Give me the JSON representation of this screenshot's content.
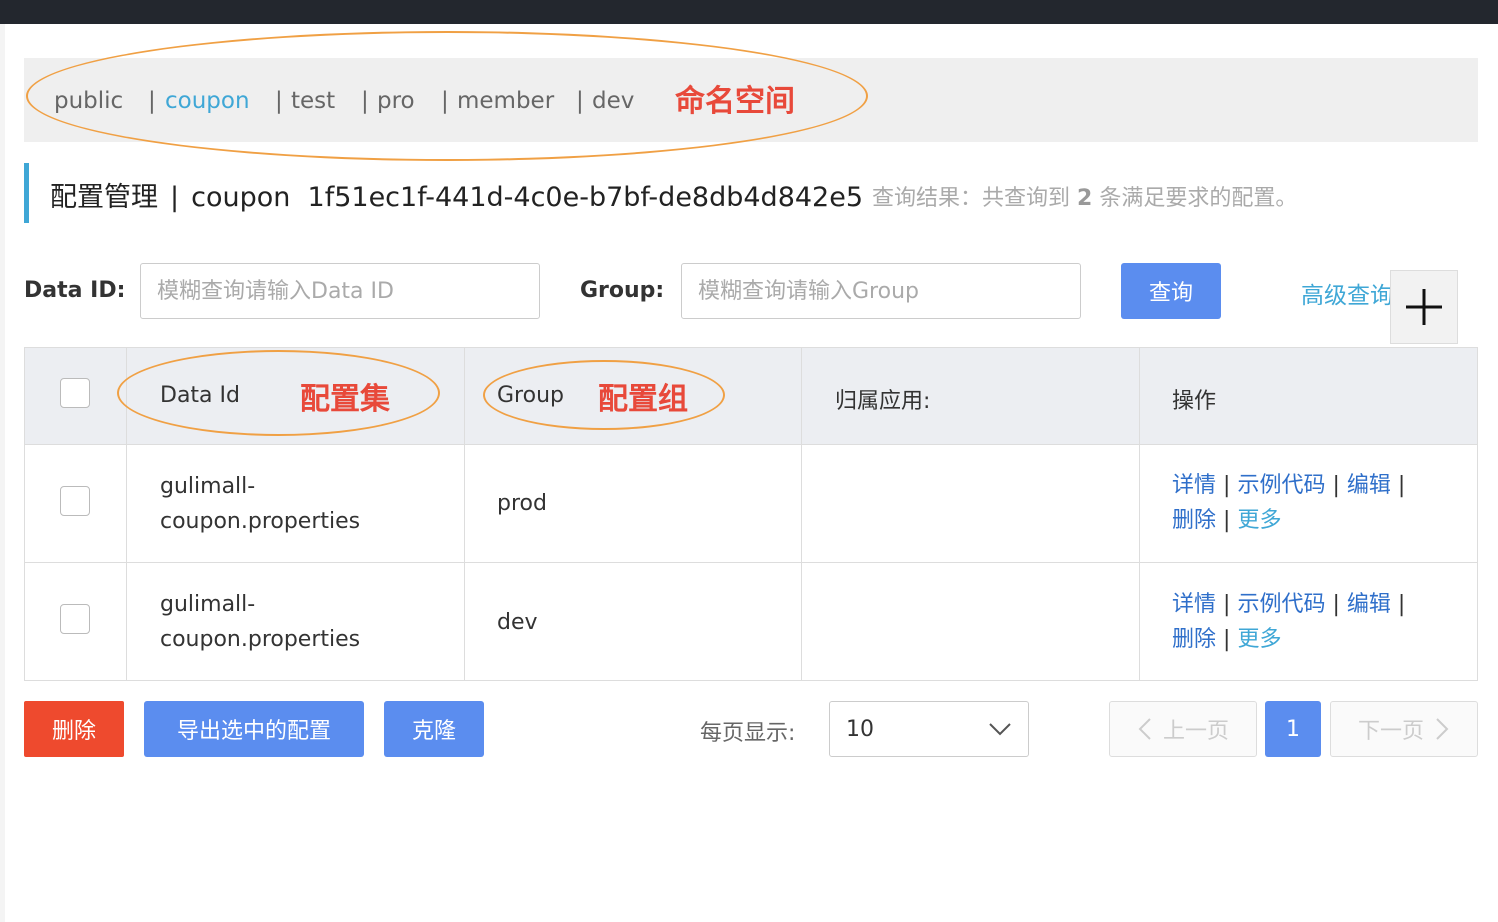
{
  "namespaces": {
    "items": [
      "public",
      "coupon",
      "test",
      "pro",
      "member",
      "dev"
    ],
    "active": "coupon",
    "separator": "|",
    "annotation": "命名空间"
  },
  "header": {
    "title": "配置管理",
    "separator": "|",
    "namespace_name": "coupon",
    "namespace_id": "1f51ec1f-441d-4c0e-b7bf-de8db4d842e5",
    "result_prefix": "查询结果：共查询到",
    "result_count": "2",
    "result_suffix": "条满足要求的配置。"
  },
  "search": {
    "data_id_label": "Data ID:",
    "data_id_placeholder": "模糊查询请输入Data ID",
    "group_label": "Group:",
    "group_placeholder": "模糊查询请输入Group",
    "query_button": "查询",
    "advanced_query": "高级查询",
    "add_icon": "plus-icon"
  },
  "table": {
    "columns": [
      "Data Id",
      "Group",
      "归属应用:",
      "操作"
    ],
    "annotations": {
      "data_id": "配置集",
      "group": "配置组"
    },
    "rows": [
      {
        "data_id_line1": "gulimall-",
        "data_id_line2": "coupon.properties",
        "group": "prod",
        "app": ""
      },
      {
        "data_id_line1": "gulimall-",
        "data_id_line2": "coupon.properties",
        "group": "dev",
        "app": ""
      }
    ],
    "actions": {
      "detail": "详情",
      "sample_code": "示例代码",
      "edit": "编辑",
      "delete": "删除",
      "more": "更多",
      "sep": "|"
    }
  },
  "footer": {
    "delete_button": "删除",
    "export_button": "导出选中的配置",
    "clone_button": "克隆",
    "page_size_label": "每页显示:",
    "page_size_value": "10",
    "prev_page": "上一页",
    "current_page": "1",
    "next_page": "下一页"
  },
  "colors": {
    "primary": "#5b8def",
    "danger": "#ee4a2e",
    "link": "#2f6fca",
    "active_namespace": "#3fa7d6",
    "annotation": "#e8493a",
    "annotation_ellipse": "#f0a044"
  }
}
